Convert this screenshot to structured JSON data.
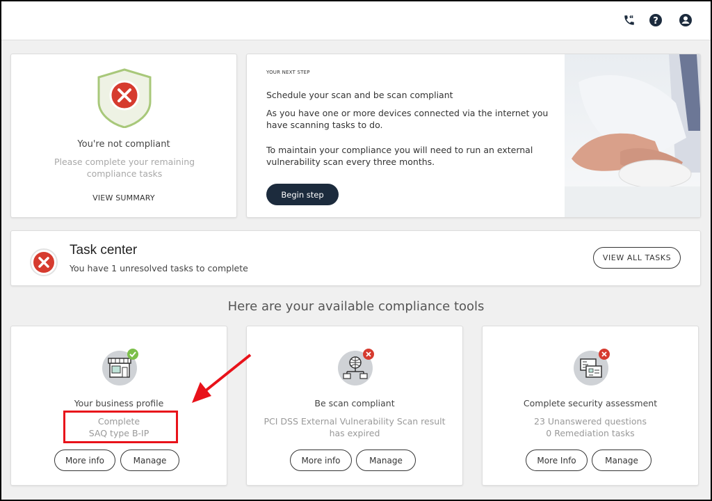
{
  "header": {
    "phone_icon": "phone-icon",
    "help_icon": "help-icon",
    "account_icon": "account-icon"
  },
  "status": {
    "title": "You're not compliant",
    "subtitle": "Please complete your remaining compliance tasks",
    "link": "VIEW SUMMARY",
    "colors": {
      "shield_fill": "#eef2e4",
      "shield_border": "#a8c87a",
      "error_red": "#d63b2f"
    }
  },
  "next_step": {
    "kicker": "YOUR NEXT STEP",
    "title": "Schedule your scan and be scan compliant",
    "paragraph1": "As you have one or more devices connected via the internet you have scanning tasks to do.",
    "paragraph2": "To maintain your compliance you will need to run an external vulnerability scan every three months.",
    "button": "Begin step",
    "button_color": "#1c2b3d"
  },
  "task_center": {
    "title": "Task center",
    "subtitle": "You have 1 unresolved tasks to complete",
    "button": "VIEW ALL TASKS"
  },
  "tools_heading": "Here are your available compliance tools",
  "tools": [
    {
      "title": "Your business profile",
      "line1": "Complete",
      "line2": "SAQ type B-IP",
      "status": "complete",
      "icon": "storefront-icon",
      "more_info": "More info",
      "manage": "Manage"
    },
    {
      "title": "Be scan compliant",
      "line1": "PCI DSS External Vulnerability Scan result",
      "line2": "has expired",
      "status": "error",
      "icon": "network-globe-icon",
      "more_info": "More info",
      "manage": "Manage"
    },
    {
      "title": "Complete security assessment",
      "line1": "23 Unanswered questions",
      "line2": "0 Remediation tasks",
      "status": "error",
      "icon": "checklist-icon",
      "more_info": "More Info",
      "manage": "Manage"
    }
  ],
  "annotation": {
    "color": "#e8121a"
  }
}
